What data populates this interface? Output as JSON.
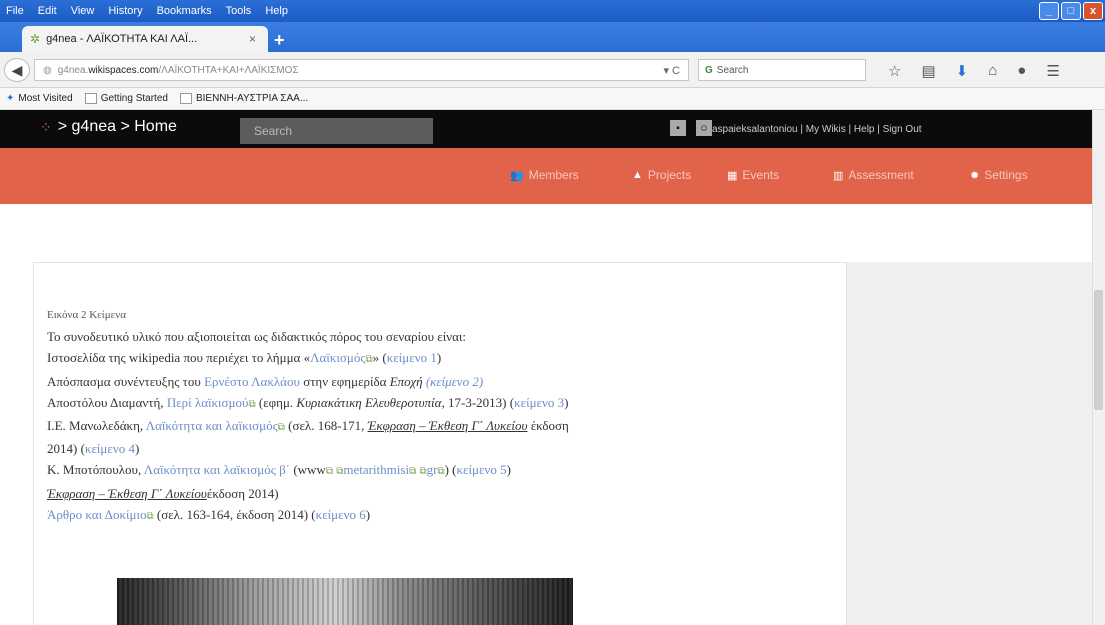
{
  "menubar": {
    "items": [
      "File",
      "Edit",
      "View",
      "History",
      "Bookmarks",
      "Tools",
      "Help"
    ]
  },
  "tab": {
    "title": "g4nea - ΛΑΪΚΟΤΗΤΑ ΚΑΙ ΛΑΪ...",
    "close": "×",
    "new": "+"
  },
  "address": {
    "prefix": "g4nea.",
    "domain": "wikispaces.com",
    "path": "/ΛΑΪΚΟΤΗΤΑ+ΚΑΙ+ΛΑΪΚΙΣΜΟΣ",
    "reload": "▾ C"
  },
  "browser_search": {
    "placeholder": "Search"
  },
  "bookmarks": {
    "items": [
      "Most Visited",
      "Getting Started",
      "ΒΙΕΝΝΗ-ΑΥΣΤΡΙΑ ΣΑΑ..."
    ]
  },
  "site": {
    "logo": "> g4nea > Home",
    "search_placeholder": "Search",
    "user_links": "aspaieksalantoniou  |  My Wikis  |  Help  |  Sign Out",
    "nav": [
      "Members",
      "Projects",
      "Events",
      "Assessment",
      "Settings"
    ]
  },
  "doc": {
    "caption": "Εικόνα 2 Κείμενα",
    "line1": "Το συνοδευτικό υλικό που αξιοποιείται ως διδακτικός πόρος του σεναρίου είναι:",
    "line2a": "Ιστοσελίδα της wikipedia που περιέχει το λήμμα «",
    "line2link": "Λαϊκισμός",
    "line2b": "» (",
    "line2ref": "κείμενο 1",
    "line2c": ")",
    "line3a": "Απόσπασμα συνέντευξης του ",
    "line3link": "Ερνέστο Λακλάου",
    "line3b": " στην εφημερίδα ",
    "line3it": "Εποχή",
    "line3ref": "(κείμενο 2)",
    "line4a": "Αποστόλου Διαμαντή, ",
    "line4link": "Περί λαϊκισμού",
    "line4b": " (εφημ. ",
    "line4it": "Κυριακάτικη Ελευθεροτυπία",
    "line4c": ", 17-3-2013) (",
    "line4ref": "κείμενο 3",
    "line4d": ")",
    "line5a": "Ι.Ε. Μανωλεδάκη, ",
    "line5link": "Λαϊκότητα και λαϊκισμός",
    "line5b": " (σελ. 168-171, ",
    "line5u": "Έκφραση – Έκθεση Γ΄ Λυκείου",
    "line5c": " έκδοση",
    "line6a": "2014) (",
    "line6ref": "κείμενο 4",
    "line6b": ")",
    "line7a": "Κ. Μποτόπουλου, ",
    "line7link": "Λαϊκότητα και λαϊκισμός β΄",
    "line7b": " (www",
    "line7c": "metarithmisi",
    "line7d": "gr",
    "line7e": ") (",
    "line7ref": "κείμενο 5",
    "line7f": ")",
    "line8u": "Έκφραση – Έκθεση Γ΄ Λυκείου",
    "line8b": "έκδοση 2014)",
    "line9link": "Άρθρο και Δοκίμιο",
    "line9b": " (σελ. 163-164, έκδοση 2014) (",
    "line9ref": "κείμενο 6",
    "line9c": ")"
  }
}
